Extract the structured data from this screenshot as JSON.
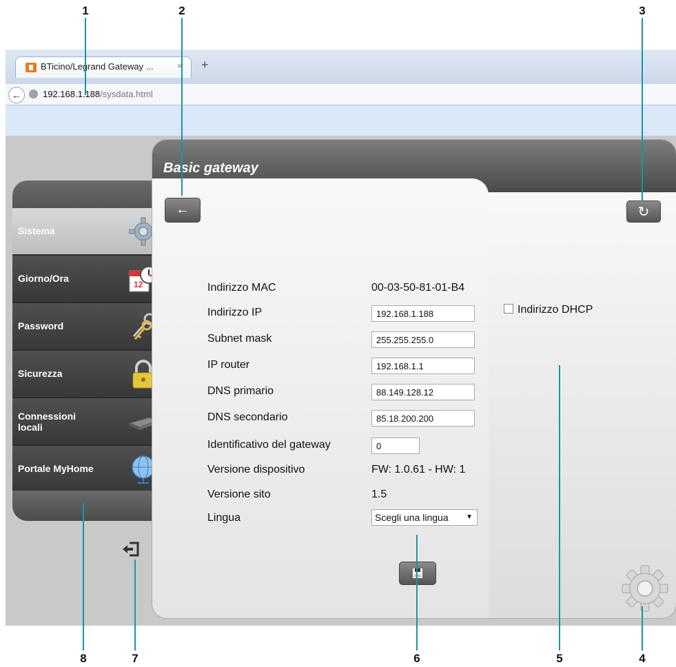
{
  "callouts": [
    "1",
    "2",
    "3",
    "4",
    "5",
    "6",
    "7",
    "8"
  ],
  "browser": {
    "tab_title": "BTicino/Legrand Gateway ...",
    "tab_close": "×",
    "new_tab": "+",
    "back": "←",
    "url_host": "192.168.1.188",
    "url_path": "/sysdata.html"
  },
  "sidebar": {
    "items": [
      {
        "label": "Sistema",
        "icon": "gear-icon"
      },
      {
        "label": "Giorno/Ora",
        "icon": "calendar-clock-icon"
      },
      {
        "label": "Password",
        "icon": "keys-icon"
      },
      {
        "label": "Sicurezza",
        "icon": "padlock-icon"
      },
      {
        "label": "Connessioni locali",
        "icon": "network-switch-icon"
      },
      {
        "label": "Portale MyHome",
        "icon": "globe-icon"
      }
    ]
  },
  "panel": {
    "title": "Basic gateway",
    "back_icon": "←",
    "refresh_icon": "↻",
    "save_icon": "💾"
  },
  "form": {
    "mac_label": "Indirizzo MAC",
    "mac_value": "00-03-50-81-01-B4",
    "ip_label": "Indirizzo IP",
    "ip_value": "192.168.1.188",
    "dhcp_label": "Indirizzo DHCP",
    "subnet_label": "Subnet mask",
    "subnet_value": "255.255.255.0",
    "router_label": "IP router",
    "router_value": "192.168.1.1",
    "dns1_label": "DNS primario",
    "dns1_value": "88.149.128.12",
    "dns2_label": "DNS secondario",
    "dns2_value": "85.18.200.200",
    "gwid_label": "Identificativo del gateway",
    "gwid_value": "0",
    "devver_label": "Versione dispositivo",
    "devver_value": "FW: 1.0.61 - HW: 1",
    "sitever_label": "Versione sito",
    "sitever_value": "1.5",
    "lang_label": "Lingua",
    "lang_value": "Scegli una lingua"
  },
  "colors": {
    "callout_line": "#1a93a8"
  }
}
